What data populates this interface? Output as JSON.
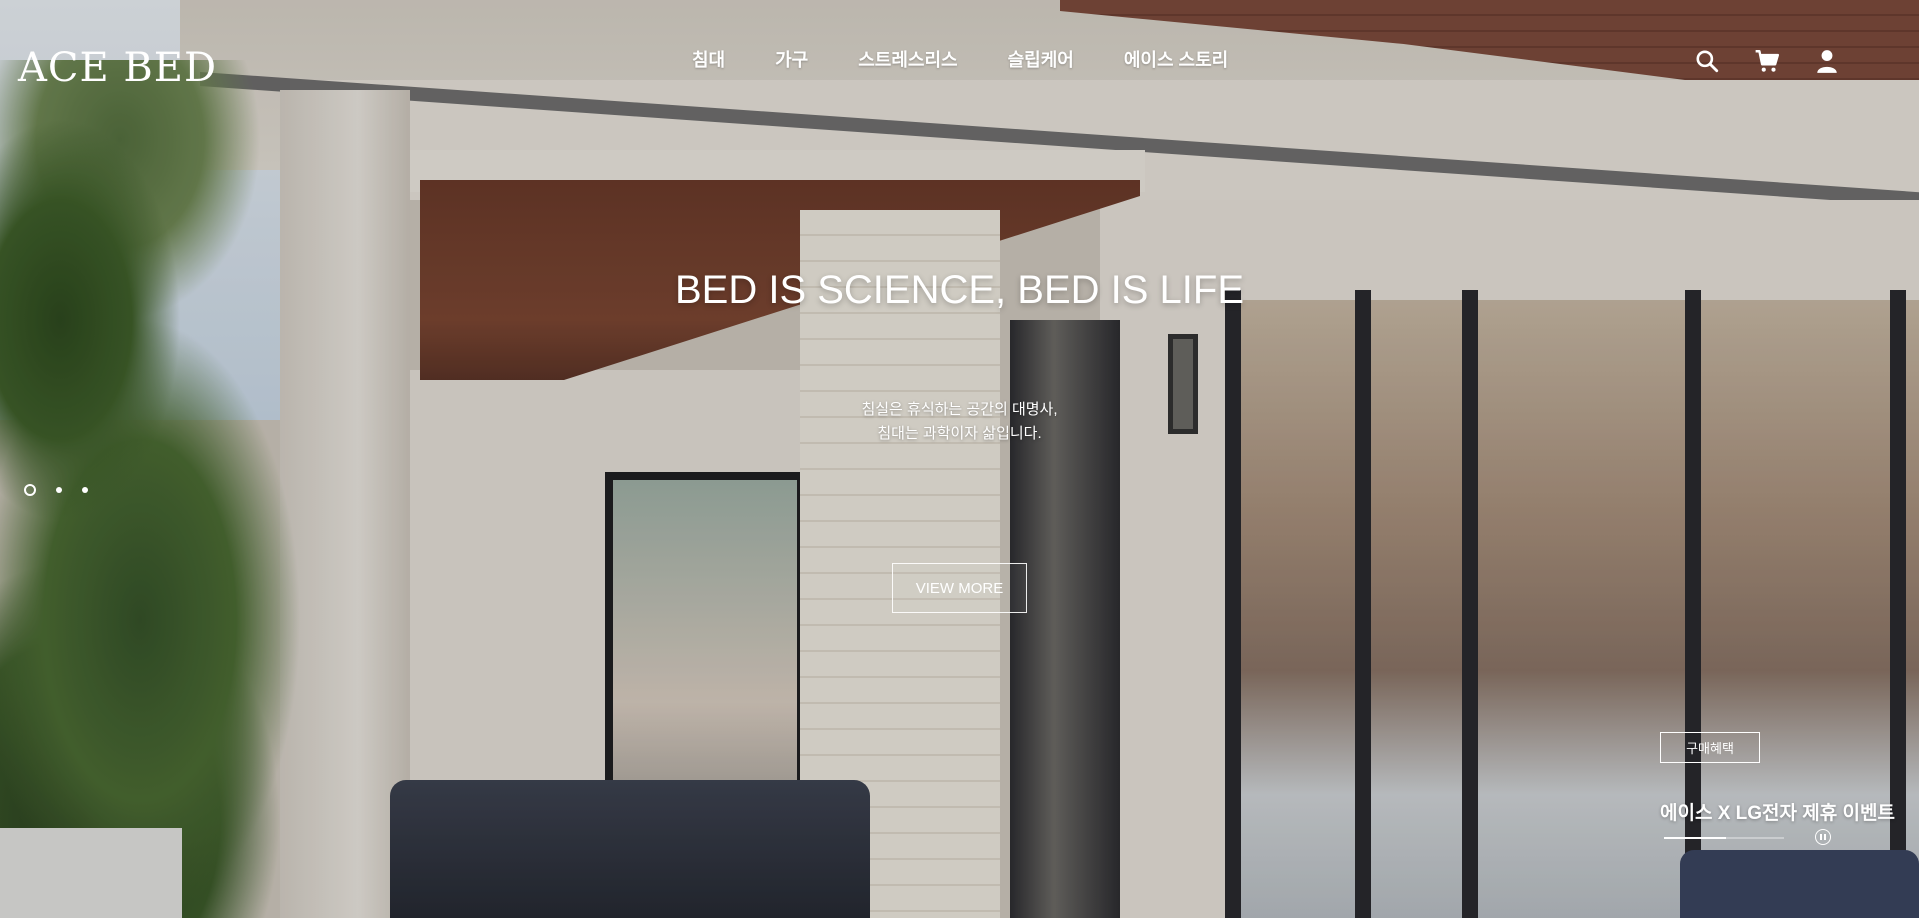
{
  "header": {
    "logo_text": "ACE BED",
    "nav": [
      {
        "label": "침대"
      },
      {
        "label": "가구"
      },
      {
        "label": "스트레스리스"
      },
      {
        "label": "슬립케어"
      },
      {
        "label": "에이스 스토리"
      }
    ],
    "icons": [
      "search-icon",
      "cart-icon",
      "user-icon"
    ]
  },
  "hero": {
    "title": "BED IS SCIENCE, BED IS LIFE",
    "subtitle_lines": [
      "침실은 휴식하는 공간의 대명사,",
      "침대는 과학이자 삶입니다."
    ],
    "button_label": "VIEW MORE"
  },
  "slider": {
    "dot_count": 3,
    "active_index": 0
  },
  "event": {
    "badge_label": "구매혜택",
    "title": "에이스 X LG전자 제휴 이벤트",
    "progress": 0.52,
    "pause_icon": "pause-icon"
  },
  "colors": {
    "text": "#ffffff",
    "overlay": "rgba(0,0,0,0.12)"
  }
}
